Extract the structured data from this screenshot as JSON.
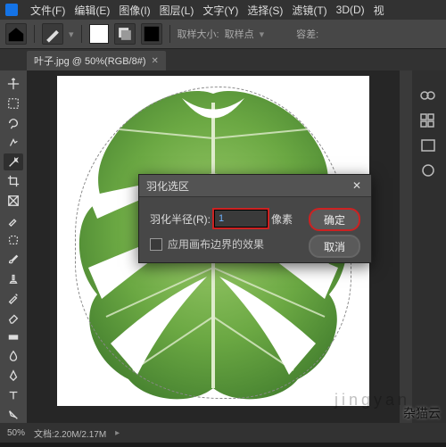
{
  "menu": {
    "items": [
      "文件(F)",
      "编辑(E)",
      "图像(I)",
      "图层(L)",
      "文字(Y)",
      "选择(S)",
      "滤镜(T)",
      "3D(D)",
      "视"
    ]
  },
  "optionbar": {
    "brush_size_label": "取样大小:",
    "brush_value": "取样点",
    "tol_label": "容差:"
  },
  "tab": {
    "label": "叶子.jpg @ 50%(RGB/8#)"
  },
  "dialog": {
    "title": "羽化选区",
    "radius_label": "羽化半径(R):",
    "radius_value": "1",
    "unit": "像素",
    "checkbox_label": "应用画布边界的效果",
    "ok": "确定",
    "cancel": "取消"
  },
  "status": {
    "zoom": "50%",
    "docinfo": "文档:2.20M/2.17M"
  },
  "watermark": "杂猫云",
  "watermark2": "jingyan"
}
